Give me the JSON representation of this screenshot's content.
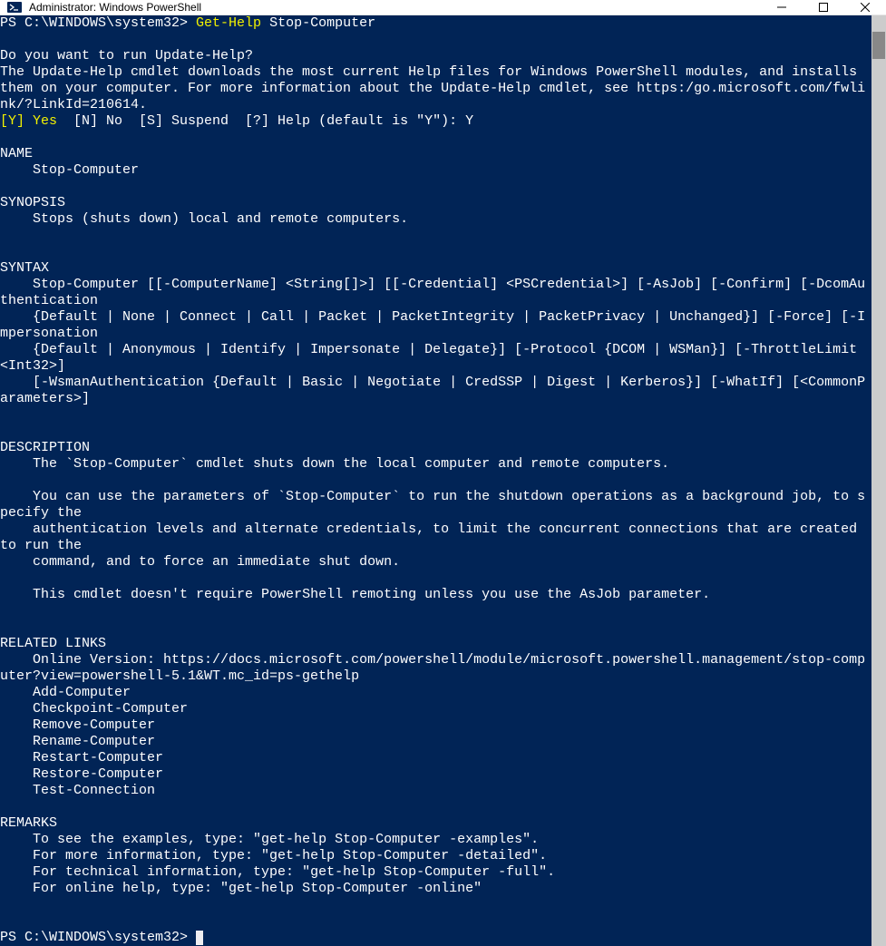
{
  "window": {
    "title": "Administrator: Windows PowerShell"
  },
  "ps": {
    "prompt1": "PS C:\\WINDOWS\\system32> ",
    "cmd": "Get-Help",
    "arg": " Stop-Computer",
    "update_q": "Do you want to run Update-Help?",
    "update_body": "The Update-Help cmdlet downloads the most current Help files for Windows PowerShell modules, and installs them on your computer. For more information about the Update-Help cmdlet, see https:/go.microsoft.com/fwlink/?LinkId=210614.",
    "choice_y": "[Y] Yes",
    "choice_rest": "  [N] No  [S] Suspend  [?] Help (default is \"Y\"): Y",
    "name_hdr": "NAME",
    "name_val": "    Stop-Computer",
    "syn_hdr": "SYNOPSIS",
    "syn_val": "    Stops (shuts down) local and remote computers.",
    "syntax_hdr": "SYNTAX",
    "syntax_val": "    Stop-Computer [[-ComputerName] <String[]>] [[-Credential] <PSCredential>] [-AsJob] [-Confirm] [-DcomAuthentication\n    {Default | None | Connect | Call | Packet | PacketIntegrity | PacketPrivacy | Unchanged}] [-Force] [-Impersonation\n    {Default | Anonymous | Identify | Impersonate | Delegate}] [-Protocol {DCOM | WSMan}] [-ThrottleLimit <Int32>]\n    [-WsmanAuthentication {Default | Basic | Negotiate | CredSSP | Digest | Kerberos}] [-WhatIf] [<CommonParameters>]",
    "desc_hdr": "DESCRIPTION",
    "desc_val": "    The `Stop-Computer` cmdlet shuts down the local computer and remote computers.\n\n    You can use the parameters of `Stop-Computer` to run the shutdown operations as a background job, to specify the\n    authentication levels and alternate credentials, to limit the concurrent connections that are created to run the\n    command, and to force an immediate shut down.\n\n    This cmdlet doesn't require PowerShell remoting unless you use the AsJob parameter.",
    "links_hdr": "RELATED LINKS",
    "links_val": "    Online Version: https://docs.microsoft.com/powershell/module/microsoft.powershell.management/stop-computer?view=powershell-5.1&WT.mc_id=ps-gethelp\n    Add-Computer\n    Checkpoint-Computer\n    Remove-Computer\n    Rename-Computer\n    Restart-Computer\n    Restore-Computer\n    Test-Connection",
    "remarks_hdr": "REMARKS",
    "remarks_val": "    To see the examples, type: \"get-help Stop-Computer -examples\".\n    For more information, type: \"get-help Stop-Computer -detailed\".\n    For technical information, type: \"get-help Stop-Computer -full\".\n    For online help, type: \"get-help Stop-Computer -online\"",
    "prompt2": "PS C:\\WINDOWS\\system32> "
  }
}
